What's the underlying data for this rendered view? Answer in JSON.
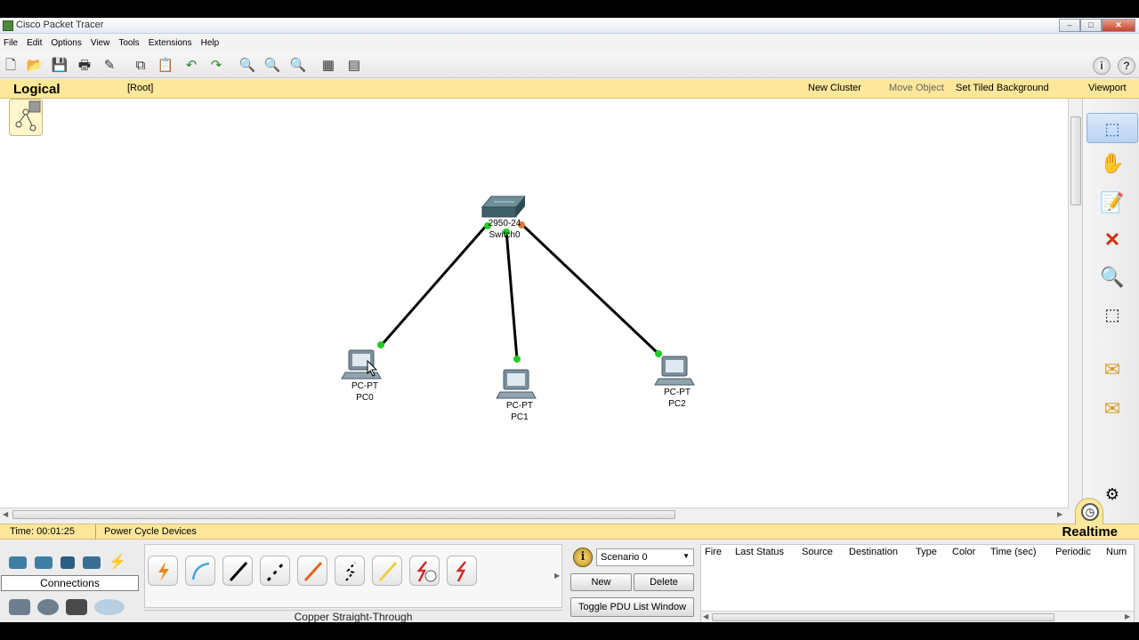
{
  "window": {
    "title": "Cisco Packet Tracer"
  },
  "menu": [
    "File",
    "Edit",
    "Options",
    "View",
    "Tools",
    "Extensions",
    "Help"
  ],
  "workspace_bar": {
    "mode": "Logical",
    "root": "[Root]",
    "new_cluster": "New Cluster",
    "move_object": "Move Object",
    "set_tiled_background": "Set Tiled Background",
    "viewport": "Viewport"
  },
  "topology": {
    "switch": {
      "model": "2950-24",
      "name": "Switch0"
    },
    "pcs": [
      {
        "model": "PC-PT",
        "name": "PC0"
      },
      {
        "model": "PC-PT",
        "name": "PC1"
      },
      {
        "model": "PC-PT",
        "name": "PC2"
      }
    ],
    "link_up_color": "#22cc22",
    "link_down_color": "#e07a3a"
  },
  "status": {
    "time": "Time: 00:01:25",
    "power_cycle": "Power Cycle Devices",
    "mode": "Realtime"
  },
  "device_panel": {
    "category_label": "Connections",
    "selected_cable": "Copper Straight-Through"
  },
  "pdu": {
    "scenario": "Scenario 0",
    "new_label": "New",
    "delete_label": "Delete",
    "toggle_label": "Toggle PDU List Window",
    "columns": [
      "Fire",
      "Last Status",
      "Source",
      "Destination",
      "Type",
      "Color",
      "Time (sec)",
      "Periodic",
      "Num"
    ]
  }
}
